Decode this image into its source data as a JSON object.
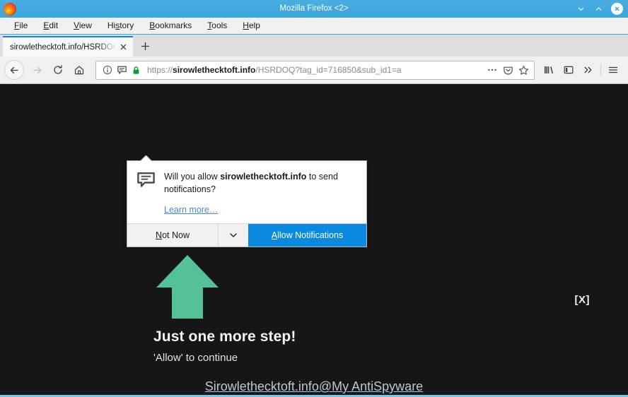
{
  "window": {
    "title": "Mozilla Firefox <2>",
    "logo_icon": "firefox-logo",
    "controls": {
      "minimize_icon": "chevron-down-icon",
      "maximize_icon": "chevron-up-icon",
      "close_icon": "close-circle-icon"
    }
  },
  "menubar": {
    "items": [
      {
        "pre": "F",
        "mnemonic": "",
        "label_full": "File",
        "rest": "ile"
      },
      {
        "pre": "E",
        "label_full": "Edit",
        "rest": "dit"
      },
      {
        "pre": "V",
        "label_full": "View",
        "rest": "iew"
      },
      {
        "pre": "Hi",
        "label_full": "History",
        "rest": "story"
      },
      {
        "pre": "B",
        "label_full": "Bookmarks",
        "rest": "ookmarks"
      },
      {
        "pre": "T",
        "label_full": "Tools",
        "rest": "ools"
      },
      {
        "pre": "H",
        "label_full": "Help",
        "rest": "elp"
      }
    ],
    "file": "File",
    "edit": "Edit",
    "view": "View",
    "history": "History",
    "bookmarks": "Bookmarks",
    "tools": "Tools",
    "help": "Help"
  },
  "tabs": {
    "active_title": "sirowlethecktoft.info/HSRDOQ",
    "close_icon": "close-icon",
    "new_tab_icon": "plus-icon"
  },
  "navbar": {
    "back_icon": "arrow-left-icon",
    "forward_icon": "arrow-right-icon",
    "reload_icon": "reload-icon",
    "home_icon": "home-icon",
    "library_icon": "library-icon",
    "sidebar_icon": "sidebar-icon",
    "overflow_icon": "double-chevron-right-icon",
    "menu_icon": "hamburger-menu-icon"
  },
  "urlbar": {
    "info_icon": "info-circle-icon",
    "notification_icon": "speech-bubble-icon",
    "lock_icon": "padlock-icon",
    "scheme": "https://",
    "host": "sirowlethecktoft.info",
    "path": "/HSRDOQ?tag_id=716850&sub_id1=a",
    "full_url": "https://sirowlethecktoft.info/HSRDOQ?tag_id=716850&sub_id1=a",
    "page_actions_icon": "ellipsis-icon",
    "pocket_icon": "pocket-icon",
    "bookmark_icon": "star-icon"
  },
  "permission_popup": {
    "icon": "speech-bubble-icon",
    "question_prefix": "Will you allow ",
    "question_host": "sirowlethecktoft.info",
    "question_suffix": " to send notifications?",
    "learn_more": "Learn more…",
    "not_now_pre": "N",
    "not_now_rest": "ot Now",
    "not_now_label": "Not Now",
    "dropdown_icon": "chevron-down-icon",
    "allow_pre": "A",
    "allow_rest": "llow Notifications",
    "allow_label": "Allow Notifications",
    "allow_color": "#0a89e0"
  },
  "page": {
    "arrow_icon": "arrow-up-icon",
    "arrow_color": "#55c196",
    "headline": "Just one more step!",
    "subline": "'Allow' to continue",
    "close_button": "[X]",
    "watermark": "Sirowlethecktoft.info@My AntiSpyware",
    "background_color": "#161616"
  }
}
